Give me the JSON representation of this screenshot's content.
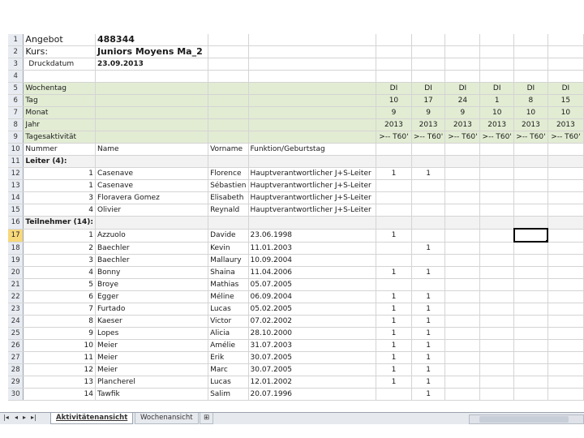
{
  "header": {
    "angebot_label": "Angebot",
    "angebot_value": "488344",
    "kurs_label": "Kurs:",
    "kurs_value": "Juniors Moyens Ma_2",
    "druck_label": "Druckdatum",
    "druck_value": "23.09.2013"
  },
  "green_rows": {
    "wochentag_label": "Wochentag",
    "tag_label": "Tag",
    "monat_label": "Monat",
    "jahr_label": "Jahr",
    "tagesaktivitaet_label": "Tagesaktivität"
  },
  "days": [
    {
      "wd": "DI",
      "tag": "10",
      "monat": "9",
      "jahr": "2013",
      "akt": ">-- T60'"
    },
    {
      "wd": "DI",
      "tag": "17",
      "monat": "9",
      "jahr": "2013",
      "akt": ">-- T60'"
    },
    {
      "wd": "DI",
      "tag": "24",
      "monat": "9",
      "jahr": "2013",
      "akt": ">-- T60'"
    },
    {
      "wd": "DI",
      "tag": "1",
      "monat": "10",
      "jahr": "2013",
      "akt": ">-- T60'"
    },
    {
      "wd": "DI",
      "tag": "8",
      "monat": "10",
      "jahr": "2013",
      "akt": ">-- T60'"
    },
    {
      "wd": "DI",
      "tag": "15",
      "monat": "10",
      "jahr": "2013",
      "akt": ">-- T60'"
    }
  ],
  "columns": {
    "nummer": "Nummer",
    "name": "Name",
    "vorname": "Vorname",
    "funktion": "Funktion/Geburtstag"
  },
  "leiter_section": "Leiter (4):",
  "leiter": [
    {
      "nr": "1",
      "name": "Casenave",
      "vorname": "Florence",
      "funktion": "Hauptverantwortlicher J+S-Leiter",
      "d": [
        "1",
        "1",
        "",
        "",
        "",
        ""
      ]
    },
    {
      "nr": "1",
      "name": "Casenave",
      "vorname": "Sébastien",
      "funktion": "Hauptverantwortlicher J+S-Leiter",
      "d": [
        "",
        "",
        "",
        "",
        "",
        ""
      ]
    },
    {
      "nr": "3",
      "name": "Floravera Gomez",
      "vorname": "Elisabeth",
      "funktion": "Hauptverantwortlicher J+S-Leiter",
      "d": [
        "",
        "",
        "",
        "",
        "",
        ""
      ]
    },
    {
      "nr": "4",
      "name": "Olivier",
      "vorname": "Reynald",
      "funktion": "Hauptverantwortlicher J+S-Leiter",
      "d": [
        "",
        "",
        "",
        "",
        "",
        ""
      ]
    }
  ],
  "teilnehmer_section": "Teilnehmer (14):",
  "teilnehmer": [
    {
      "nr": "1",
      "name": "Azzuolo",
      "vorname": "Davide",
      "funktion": "23.06.1998",
      "d": [
        "1",
        "",
        "",
        "",
        "",
        ""
      ]
    },
    {
      "nr": "2",
      "name": "Baechler",
      "vorname": "Kevin",
      "funktion": "11.01.2003",
      "d": [
        "",
        "1",
        "",
        "",
        "",
        ""
      ]
    },
    {
      "nr": "3",
      "name": "Baechler",
      "vorname": "Mallaury",
      "funktion": "10.09.2004",
      "d": [
        "",
        "",
        "",
        "",
        "",
        ""
      ]
    },
    {
      "nr": "4",
      "name": "Bonny",
      "vorname": "Shaina",
      "funktion": "11.04.2006",
      "d": [
        "1",
        "1",
        "",
        "",
        "",
        ""
      ]
    },
    {
      "nr": "5",
      "name": "Broye",
      "vorname": "Mathias",
      "funktion": "05.07.2005",
      "d": [
        "",
        "",
        "",
        "",
        "",
        ""
      ]
    },
    {
      "nr": "6",
      "name": "Egger",
      "vorname": "Méline",
      "funktion": "06.09.2004",
      "d": [
        "1",
        "1",
        "",
        "",
        "",
        ""
      ]
    },
    {
      "nr": "7",
      "name": "Furtado",
      "vorname": "Lucas",
      "funktion": "05.02.2005",
      "d": [
        "1",
        "1",
        "",
        "",
        "",
        ""
      ]
    },
    {
      "nr": "8",
      "name": "Kaeser",
      "vorname": "Victor",
      "funktion": "07.02.2002",
      "d": [
        "1",
        "1",
        "",
        "",
        "",
        ""
      ]
    },
    {
      "nr": "9",
      "name": "Lopes",
      "vorname": "Alicia",
      "funktion": "28.10.2000",
      "d": [
        "1",
        "1",
        "",
        "",
        "",
        ""
      ]
    },
    {
      "nr": "10",
      "name": "Meier",
      "vorname": "Amélie",
      "funktion": "31.07.2003",
      "d": [
        "1",
        "1",
        "",
        "",
        "",
        ""
      ]
    },
    {
      "nr": "11",
      "name": "Meier",
      "vorname": "Erik",
      "funktion": "30.07.2005",
      "d": [
        "1",
        "1",
        "",
        "",
        "",
        ""
      ]
    },
    {
      "nr": "12",
      "name": "Meier",
      "vorname": "Marc",
      "funktion": "30.07.2005",
      "d": [
        "1",
        "1",
        "",
        "",
        "",
        ""
      ]
    },
    {
      "nr": "13",
      "name": "Plancherel",
      "vorname": "Lucas",
      "funktion": "12.01.2002",
      "d": [
        "1",
        "1",
        "",
        "",
        "",
        ""
      ]
    },
    {
      "nr": "14",
      "name": "Tawfik",
      "vorname": "Salim",
      "funktion": "20.07.1996",
      "d": [
        "",
        "1",
        "",
        "",
        "",
        ""
      ]
    }
  ],
  "row_numbers": [
    "1",
    "2",
    "3",
    "4",
    "5",
    "6",
    "7",
    "8",
    "9",
    "10",
    "11",
    "12",
    "13",
    "14",
    "15",
    "16",
    "17",
    "18",
    "19",
    "20",
    "21",
    "22",
    "23",
    "24",
    "25",
    "26",
    "27",
    "28",
    "29",
    "30"
  ],
  "tabs": {
    "active": "Aktivitätenansicht",
    "inactive": "Wochenansicht"
  },
  "icons": {
    "nav_first": "first-sheet-icon",
    "nav_prev": "prev-sheet-icon",
    "nav_next": "next-sheet-icon",
    "nav_last": "last-sheet-icon",
    "new_sheet": "insert-sheet-icon"
  },
  "colors": {
    "green_band": "#e2ecd3",
    "row_header": "#e8ecf2",
    "selected_row_header": "#f7d87a"
  }
}
